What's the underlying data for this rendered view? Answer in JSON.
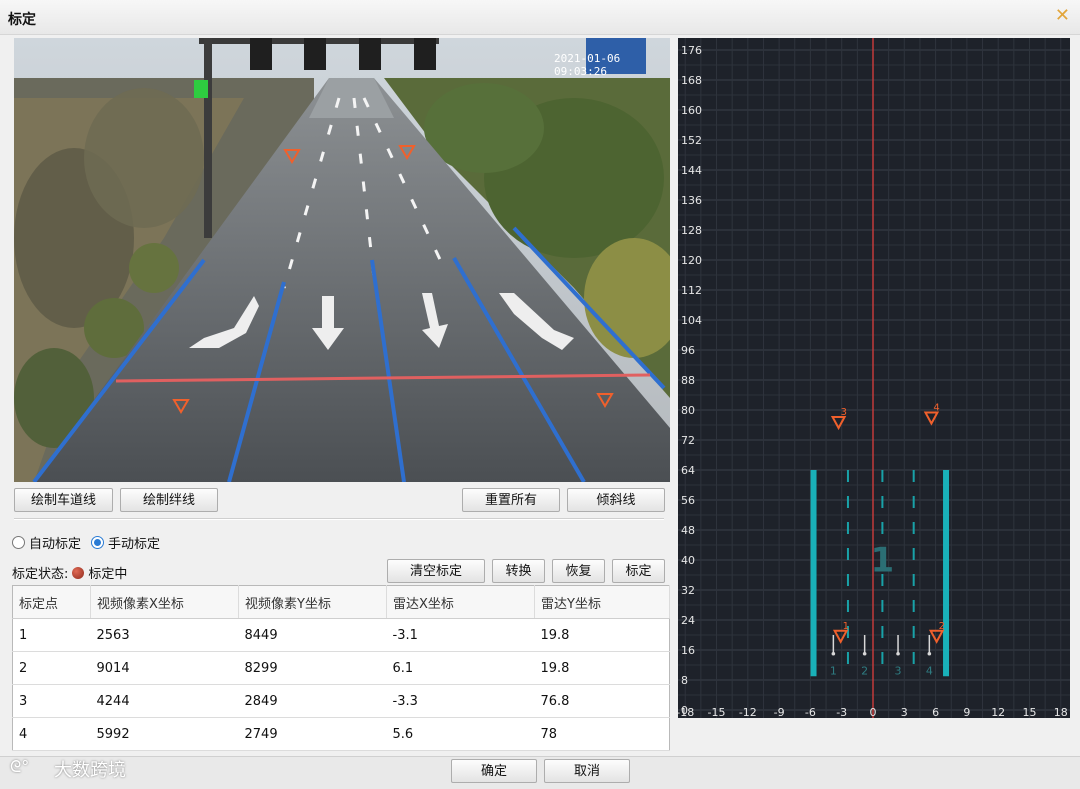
{
  "window": {
    "title": "标定",
    "close_icon": "close-icon"
  },
  "video": {
    "timestamp": "2021-01-06 09:03:26"
  },
  "toolbar": {
    "draw_lane": "绘制车道线",
    "draw_trip": "绘制绊线",
    "reset_all": "重置所有",
    "tilt_line": "倾斜线"
  },
  "mode": {
    "auto": "自动标定",
    "manual": "手动标定",
    "selected": "manual"
  },
  "status": {
    "label": "标定状态:",
    "value": "标定中"
  },
  "actions": {
    "clear": "清空标定",
    "convert": "转换",
    "restore": "恢复",
    "calibrate": "标定"
  },
  "table": {
    "headers": [
      "标定点",
      "视频像素X坐标",
      "视频像素Y坐标",
      "雷达X坐标",
      "雷达Y坐标"
    ],
    "rows": [
      [
        "1",
        "2563",
        "8449",
        "-3.1",
        "19.8"
      ],
      [
        "2",
        "9014",
        "8299",
        "6.1",
        "19.8"
      ],
      [
        "3",
        "4244",
        "2849",
        "-3.3",
        "76.8"
      ],
      [
        "4",
        "5992",
        "2749",
        "5.6",
        "78"
      ]
    ]
  },
  "radar": {
    "y_ticks": [
      "176",
      "168",
      "160",
      "152",
      "144",
      "136",
      "128",
      "120",
      "112",
      "104",
      "96",
      "88",
      "80",
      "72",
      "64",
      "56",
      "48",
      "40",
      "32",
      "24",
      "16",
      "8",
      "0"
    ],
    "x_ticks": [
      "-18",
      "-15",
      "-12",
      "-9",
      "-6",
      "-3",
      "0",
      "3",
      "6",
      "9",
      "12",
      "15",
      "18"
    ],
    "zone_label": "1",
    "lane_labels": [
      "1",
      "2",
      "3",
      "4"
    ],
    "points": [
      {
        "id": "1",
        "x": -3.1,
        "y": 19.8
      },
      {
        "id": "2",
        "x": 6.1,
        "y": 19.8
      },
      {
        "id": "3",
        "x": -3.3,
        "y": 76.8
      },
      {
        "id": "4",
        "x": 5.6,
        "y": 78
      }
    ]
  },
  "footer": {
    "ok": "确定",
    "cancel": "取消",
    "watermark": "大数跨境"
  }
}
